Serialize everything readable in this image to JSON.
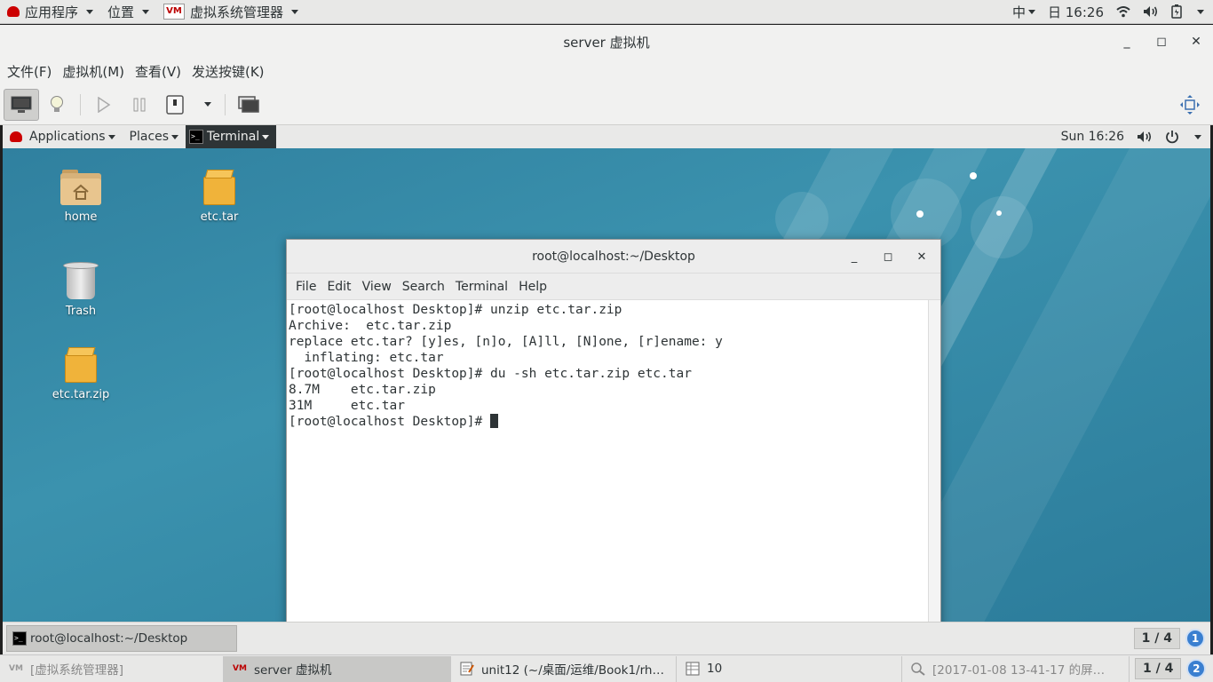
{
  "host_topbar": {
    "apps_menu": "应用程序",
    "places_menu": "位置",
    "active_app": "虚拟系统管理器",
    "input_method": "中",
    "clock": "日 16:26"
  },
  "vm_window": {
    "title": "server 虚拟机",
    "menu": [
      "文件(F)",
      "虚拟机(M)",
      "查看(V)",
      "发送按键(K)"
    ]
  },
  "guest": {
    "topbar": {
      "applications": "Applications",
      "places": "Places",
      "active_app": "Terminal",
      "clock": "Sun 16:26"
    },
    "desktop_icons": {
      "home": "home",
      "trash": "Trash",
      "etc_tar": "etc.tar",
      "etc_tar_zip": "etc.tar.zip"
    },
    "terminal": {
      "title": "root@localhost:~/Desktop",
      "menu": [
        "File",
        "Edit",
        "View",
        "Search",
        "Terminal",
        "Help"
      ],
      "lines": [
        "[root@localhost Desktop]# unzip etc.tar.zip",
        "Archive:  etc.tar.zip",
        "replace etc.tar? [y]es, [n]o, [A]ll, [N]one, [r]ename: y",
        "  inflating: etc.tar",
        "[root@localhost Desktop]# du -sh etc.tar.zip etc.tar",
        "8.7M    etc.tar.zip",
        "31M     etc.tar",
        "[root@localhost Desktop]# "
      ]
    },
    "bottombar": {
      "task": "root@localhost:~/Desktop",
      "workspace": "1 / 4",
      "badge": "1"
    }
  },
  "host_taskbar": {
    "tasks": [
      "[虚拟系统管理器]",
      "server 虚拟机",
      "unit12 (~/桌面/运维/Book1/rh…",
      "10",
      "[2017-01-08 13-41-17 的屏…"
    ],
    "workspace": "1 / 4",
    "badge": "2"
  }
}
